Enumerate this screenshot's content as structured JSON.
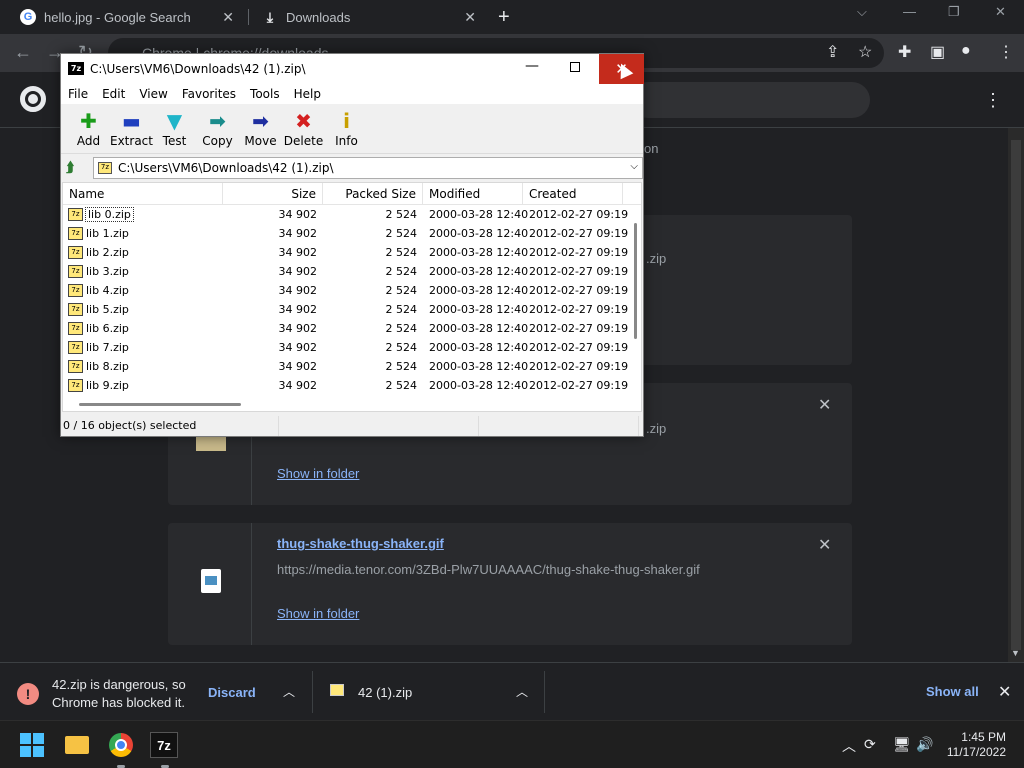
{
  "browser": {
    "tabs": [
      {
        "label": "hello.jpg - Google Search",
        "favicon": "google-icon"
      },
      {
        "label": "Downloads",
        "favicon": "download-icon"
      }
    ],
    "omnibox_text": "Chrome  |  chrome://downloads"
  },
  "downloads_page": {
    "cards": [
      {
        "partial_name": ".zip",
        "show_in_folder": ""
      },
      {
        "partial_name": ".zip",
        "show_in_folder": "Show in folder"
      },
      {
        "file_name": "thug-shake-thug-shaker.gif",
        "url": "https://media.tenor.com/3ZBd-Plw7UUAAAAC/thug-shake-thug-shaker.gif",
        "show_in_folder": "Show in folder"
      }
    ],
    "obscured_label": "on"
  },
  "shelf": {
    "warning_line1": "42.zip is dangerous, so",
    "warning_line2": "Chrome has blocked it.",
    "discard": "Discard",
    "item_name": "42 (1).zip",
    "show_all": "Show all"
  },
  "zip_window": {
    "title": "C:\\Users\\VM6\\Downloads\\42 (1).zip\\",
    "menu": [
      "File",
      "Edit",
      "View",
      "Favorites",
      "Tools",
      "Help"
    ],
    "toolbar": [
      {
        "label": "Add",
        "icon": "add-icon",
        "color": "#1a9c1a"
      },
      {
        "label": "Extract",
        "icon": "extract-icon",
        "color": "#1f3fbf"
      },
      {
        "label": "Test",
        "icon": "test-icon",
        "color": "#1fb5c9"
      },
      {
        "label": "Copy",
        "icon": "copy-icon",
        "color": "#1a8c8c"
      },
      {
        "label": "Move",
        "icon": "move-icon",
        "color": "#1f2fa0"
      },
      {
        "label": "Delete",
        "icon": "delete-icon",
        "color": "#d42020"
      },
      {
        "label": "Info",
        "icon": "info-icon",
        "color": "#c8a000"
      }
    ],
    "address": "C:\\Users\\VM6\\Downloads\\42 (1).zip\\",
    "columns": [
      "Name",
      "Size",
      "Packed Size",
      "Modified",
      "Created"
    ],
    "rows": [
      {
        "name": "lib 0.zip",
        "size": "34 902",
        "packed": "2 524",
        "modified": "2000-03-28 12:40",
        "created": "2012-02-27 09:19"
      },
      {
        "name": "lib 1.zip",
        "size": "34 902",
        "packed": "2 524",
        "modified": "2000-03-28 12:40",
        "created": "2012-02-27 09:19"
      },
      {
        "name": "lib 2.zip",
        "size": "34 902",
        "packed": "2 524",
        "modified": "2000-03-28 12:40",
        "created": "2012-02-27 09:19"
      },
      {
        "name": "lib 3.zip",
        "size": "34 902",
        "packed": "2 524",
        "modified": "2000-03-28 12:40",
        "created": "2012-02-27 09:19"
      },
      {
        "name": "lib 4.zip",
        "size": "34 902",
        "packed": "2 524",
        "modified": "2000-03-28 12:40",
        "created": "2012-02-27 09:19"
      },
      {
        "name": "lib 5.zip",
        "size": "34 902",
        "packed": "2 524",
        "modified": "2000-03-28 12:40",
        "created": "2012-02-27 09:19"
      },
      {
        "name": "lib 6.zip",
        "size": "34 902",
        "packed": "2 524",
        "modified": "2000-03-28 12:40",
        "created": "2012-02-27 09:19"
      },
      {
        "name": "lib 7.zip",
        "size": "34 902",
        "packed": "2 524",
        "modified": "2000-03-28 12:40",
        "created": "2012-02-27 09:19"
      },
      {
        "name": "lib 8.zip",
        "size": "34 902",
        "packed": "2 524",
        "modified": "2000-03-28 12:40",
        "created": "2012-02-27 09:19"
      },
      {
        "name": "lib 9.zip",
        "size": "34 902",
        "packed": "2 524",
        "modified": "2000-03-28 12:40",
        "created": "2012-02-27 09:19"
      }
    ],
    "status": "0 / 16 object(s) selected"
  },
  "taskbar": {
    "time": "1:45 PM",
    "date": "11/17/2022",
    "apps": [
      "start-icon",
      "file-explorer-icon",
      "chrome-icon",
      "7zip-icon"
    ]
  }
}
